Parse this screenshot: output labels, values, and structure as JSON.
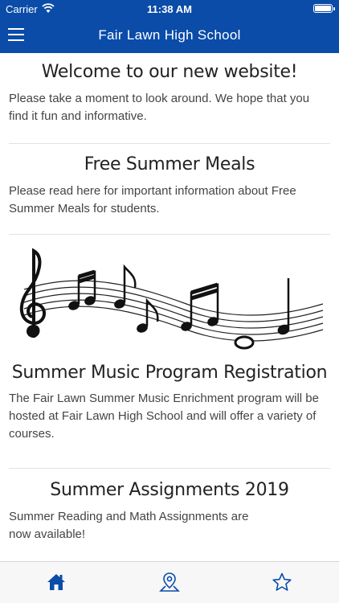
{
  "status_bar": {
    "carrier": "Carrier",
    "time": "11:38 AM"
  },
  "nav_bar": {
    "title": "Fair Lawn High School",
    "menu_icon": "hamburger-menu-icon"
  },
  "articles": [
    {
      "title": "Welcome to our new website!",
      "body": "Please take a moment to look around. We hope that you find it fun and informative."
    },
    {
      "title": "Free Summer Meals",
      "body": "Please read here for important information about Free Summer Meals for students."
    },
    {
      "title": "Summer Music Program Registration",
      "body": "The Fair Lawn Summer Music Enrichment program will be hosted at Fair Lawn High School and will offer a variety of courses."
    },
    {
      "title": "Summer Assignments 2019",
      "body_line1": "Summer Reading and Math Assignments are",
      "body_line2": "now available!"
    }
  ],
  "tab_bar": {
    "tabs": [
      "home-icon",
      "map-pin-icon",
      "star-icon"
    ],
    "active": "home-icon",
    "active_color": "#0a4ca8",
    "inactive_color": "#0a4ca8"
  },
  "colors": {
    "brand": "#0a4ca8",
    "divider": "#e2e2e2"
  }
}
